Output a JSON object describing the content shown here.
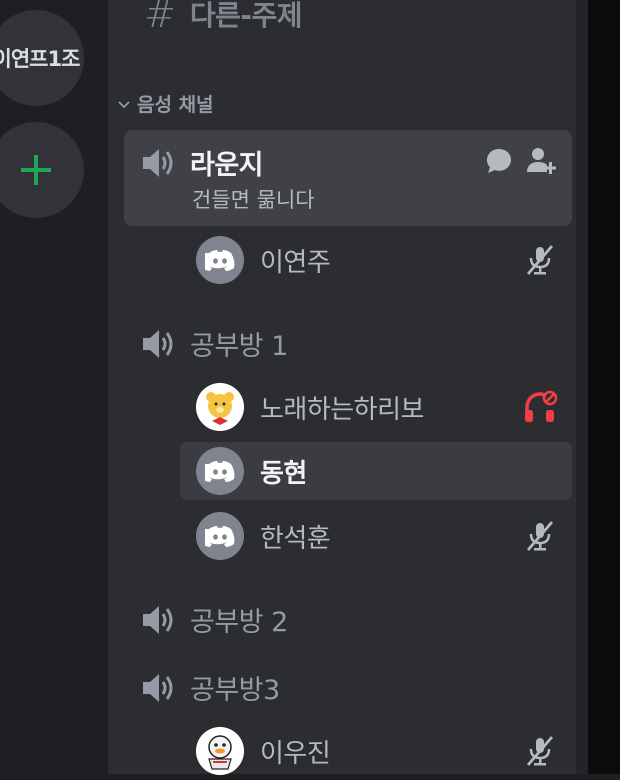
{
  "server_rail": {
    "server_name": "이연프1조",
    "add_server_symbol": "+"
  },
  "text_channel": {
    "hash": "#",
    "name": "다른-주제"
  },
  "category": {
    "label": "음성 채널"
  },
  "voice_channels": [
    {
      "name": "라운지",
      "status": "건들면 묾니다",
      "members": [
        {
          "name": "이연주",
          "avatar": "discord-logo",
          "state": "muted"
        }
      ]
    },
    {
      "name": "공부방 1",
      "members": [
        {
          "name": "노래하는하리보",
          "avatar": "bear-picture",
          "state": "deafened"
        },
        {
          "name": "동현",
          "avatar": "discord-logo",
          "state": "none"
        },
        {
          "name": "한석훈",
          "avatar": "discord-logo",
          "state": "muted"
        }
      ]
    },
    {
      "name": "공부방 2",
      "members": []
    },
    {
      "name": "공부방3",
      "members": [
        {
          "name": "이우진",
          "avatar": "duck-picture",
          "state": "muted"
        }
      ]
    }
  ],
  "colors": {
    "server_rail_bg": "#1e1f22",
    "channel_panel_bg": "#2b2d31",
    "selected_channel_bg": "#3f4147",
    "add_server_green": "#23a559",
    "deafen_red": "#f23f43",
    "muted_text": "#949ba4"
  }
}
